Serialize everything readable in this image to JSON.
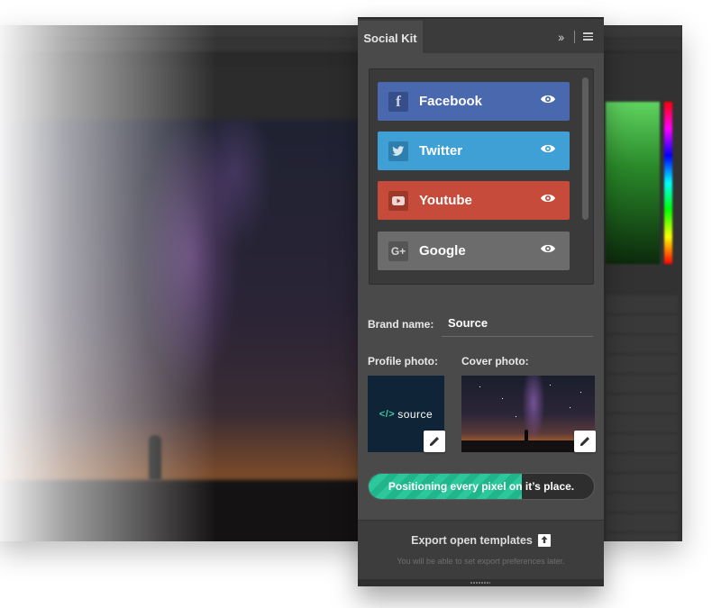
{
  "panel": {
    "tab_title": "Social Kit",
    "collapse_icon": "double-chevron-right-icon",
    "menu_icon": "hamburger-menu-icon"
  },
  "networks": [
    {
      "label": "Facebook",
      "icon": "f",
      "color": "#4a68ad",
      "icon_bg": "#364f8a"
    },
    {
      "label": "Twitter",
      "icon": "twitter-bird",
      "color": "#3fa0d6",
      "icon_bg": "#2f7fae"
    },
    {
      "label": "Youtube",
      "icon": "youtube-play",
      "color": "#c64b3a",
      "icon_bg": "#9e3829"
    },
    {
      "label": "Google",
      "icon": "G+",
      "color": "#6c6c6c",
      "icon_bg": "#555555"
    }
  ],
  "fields": {
    "brand_label": "Brand name:",
    "brand_value": "Source",
    "profile_label": "Profile photo:",
    "cover_label": "Cover photo:",
    "profile_logo_text": "source",
    "profile_logo_code": "</>"
  },
  "progress": {
    "text": "Positioning every pixel on it’s place.",
    "fraction": 0.68,
    "color": "#21b58c"
  },
  "export": {
    "label": "Export open templates",
    "hint": "You will be able to set export preferences later."
  }
}
